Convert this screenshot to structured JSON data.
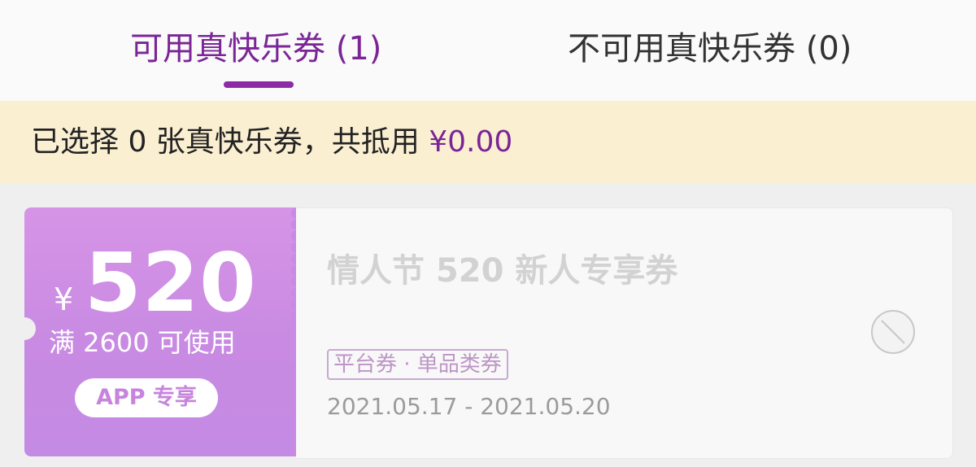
{
  "tabs": [
    {
      "label": "可用真快乐券 (1)",
      "active": true
    },
    {
      "label": "不可用真快乐券 (0)",
      "active": false
    }
  ],
  "banner": {
    "prefix": "已选择 0 张真快乐券，共抵用",
    "amount": "¥0.00"
  },
  "coupon": {
    "currency": "¥",
    "amount": "520",
    "condition": "满 2600 可使用",
    "badge": "APP 专享",
    "title": "情人节 520 新人专享券",
    "tag": "平台券 · 单品类券",
    "date_range": "2021.05.17 - 2021.05.20",
    "status_icon": "disabled-circle-icon"
  },
  "colors": {
    "accent": "#8d2ba6",
    "coupon_gradient_top": "#d694e6",
    "coupon_gradient_bottom": "#c48be4",
    "banner_bg": "#fbefd2"
  }
}
